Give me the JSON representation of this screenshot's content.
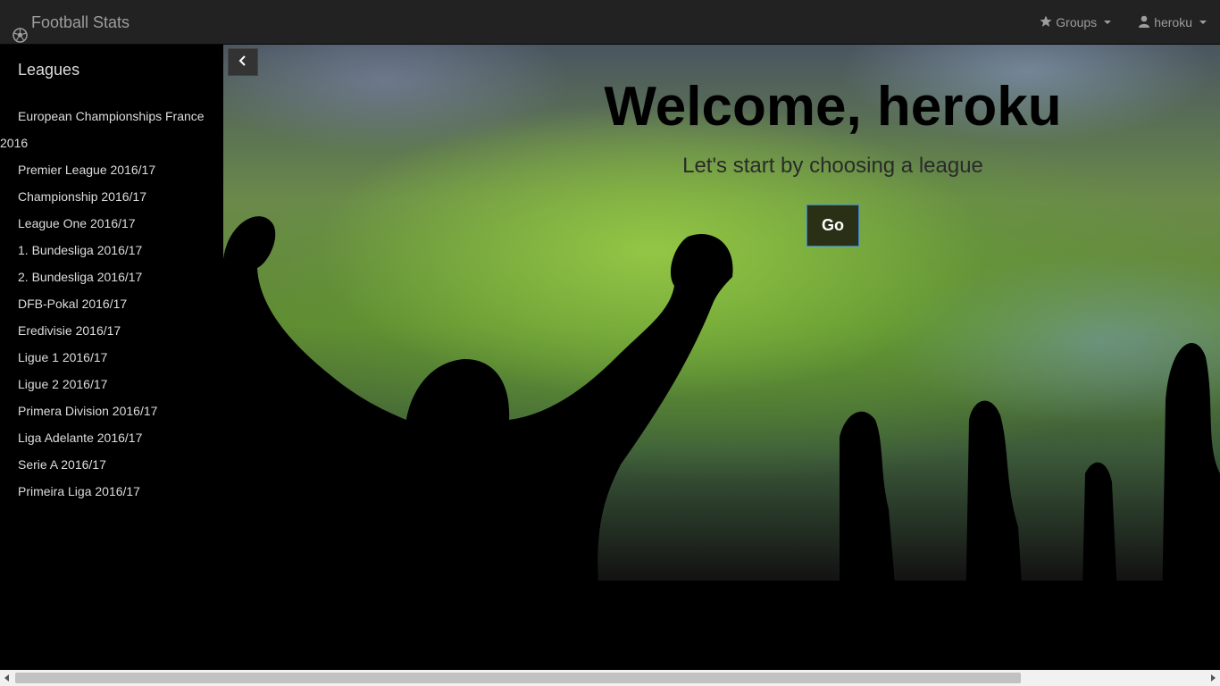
{
  "navbar": {
    "brand_icon": "soccer-ball-icon",
    "brand": "Football Stats",
    "groups": {
      "icon": "star-icon",
      "label": "Groups"
    },
    "user": {
      "icon": "user-icon",
      "label": "heroku"
    }
  },
  "sidebar": {
    "title": "Leagues",
    "items": [
      "European Championships France 2016",
      "Premier League 2016/17",
      "Championship 2016/17",
      "League One 2016/17",
      "1. Bundesliga 2016/17",
      "2. Bundesliga 2016/17",
      "DFB-Pokal 2016/17",
      "Eredivisie 2016/17",
      "Ligue 1 2016/17",
      "Ligue 2 2016/17",
      "Primera Division 2016/17",
      "Liga Adelante 2016/17",
      "Serie A 2016/17",
      "Primeira Liga 2016/17"
    ]
  },
  "toggle": {
    "icon": "chevron-left-icon"
  },
  "hero": {
    "title": "Welcome, heroku",
    "subtitle": "Let's start by choosing a league",
    "go_label": "Go"
  },
  "colors": {
    "navbar_bg": "#222222",
    "navbar_text": "#9d9d9d",
    "sidebar_bg": "#000000",
    "go_button_bg": "#2a3015",
    "go_button_border": "#3a7bd5"
  }
}
